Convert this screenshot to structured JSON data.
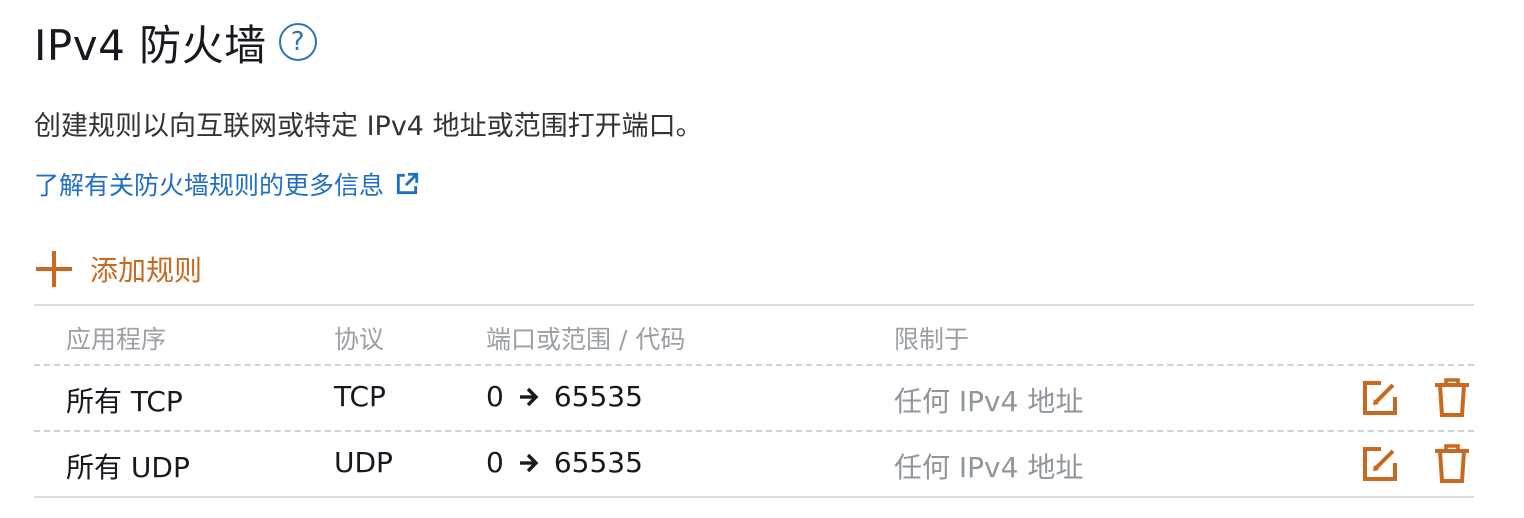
{
  "header": {
    "title": "IPv4 防火墙",
    "help_icon": "help-circle-icon",
    "description": "创建规则以向互联网或特定 IPv4 地址或范围打开端口。",
    "learn_more_link": "了解有关防火墙规则的更多信息",
    "external_link_icon": "external-link-icon"
  },
  "actions": {
    "add_rule_label": "添加规则",
    "add_rule_icon": "plus-icon"
  },
  "table": {
    "columns": [
      "应用程序",
      "协议",
      "端口或范围 / 代码",
      "限制于"
    ],
    "rows": [
      {
        "application": "所有 TCP",
        "protocol": "TCP",
        "port_from": "0",
        "port_to": "65535",
        "restricted_to": "任何 IPv4 地址"
      },
      {
        "application": "所有 UDP",
        "protocol": "UDP",
        "port_from": "0",
        "port_to": "65535",
        "restricted_to": "任何 IPv4 地址"
      }
    ],
    "row_icons": [
      "edit-icon",
      "delete-icon"
    ]
  },
  "colors": {
    "accent_orange": "#c9691f",
    "link_blue": "#1f6fc6",
    "text_dark": "#16191f",
    "text_muted": "#8f969c"
  }
}
